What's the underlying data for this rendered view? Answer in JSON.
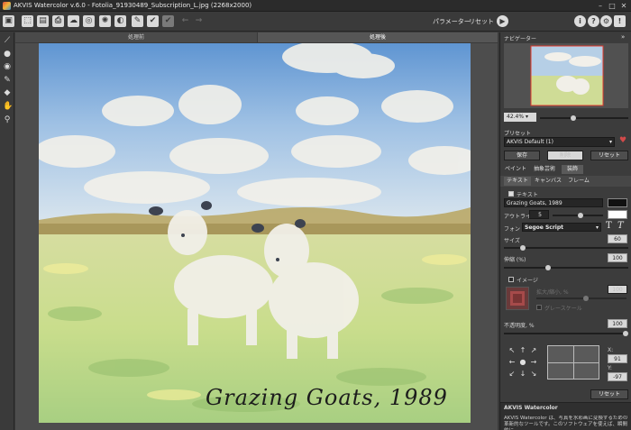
{
  "window": {
    "title": "AKVIS Watercolor v.6.0 - Fotolia_91930489_Subscription_L.jpg (2268x2000)"
  },
  "toolbar": {
    "params_label": "パラメーター",
    "reset_label": "リセット"
  },
  "canvas": {
    "tab_before": "処理前",
    "tab_after": "処理後",
    "caption": "Grazing Goats, 1989"
  },
  "navigator": {
    "title": "ナビゲーター",
    "zoom": "42.4%"
  },
  "presets": {
    "title": "プリセット",
    "selected": "AKVIS Default (1)",
    "save_label": "保存",
    "delete_label": "削除",
    "reset_label": "リセット"
  },
  "tabs": {
    "main": [
      "ペイント",
      "抽象芸術",
      "装飾"
    ],
    "main_active": 2,
    "sub": [
      "テキスト",
      "キャンバス",
      "フレーム"
    ],
    "sub_active": 0
  },
  "text_settings": {
    "text_checkbox": "テキスト",
    "text_value": "Grazing Goats, 1989",
    "outline_label": "アウトライン",
    "outline_value": "5",
    "font_label": "フォント",
    "font_value": "Segoe Script",
    "size_label": "サイズ",
    "size_value": "60",
    "stretch_label": "伸縮 (%)",
    "stretch_value": "100",
    "image_checkbox": "イメージ",
    "scale_label": "拡大/縮小, %",
    "scale_value": "100",
    "grayscale_label": "グレースケール",
    "opacity_label": "不透明度, %",
    "opacity_value": "100",
    "x_label": "X:",
    "x_value": "91",
    "y_label": "Y:",
    "y_value": "-97",
    "reset_label": "リセット"
  },
  "help": {
    "title": "AKVIS Watercolor",
    "body": "AKVIS Watercolor は、写真を水彩画に変換するための革新的なツールです。このソフトウェアを使えば、瞬間的に"
  },
  "colors": {
    "text_color": "#111111",
    "outline_color": "#ffffff",
    "heart": "#d24a4a"
  }
}
